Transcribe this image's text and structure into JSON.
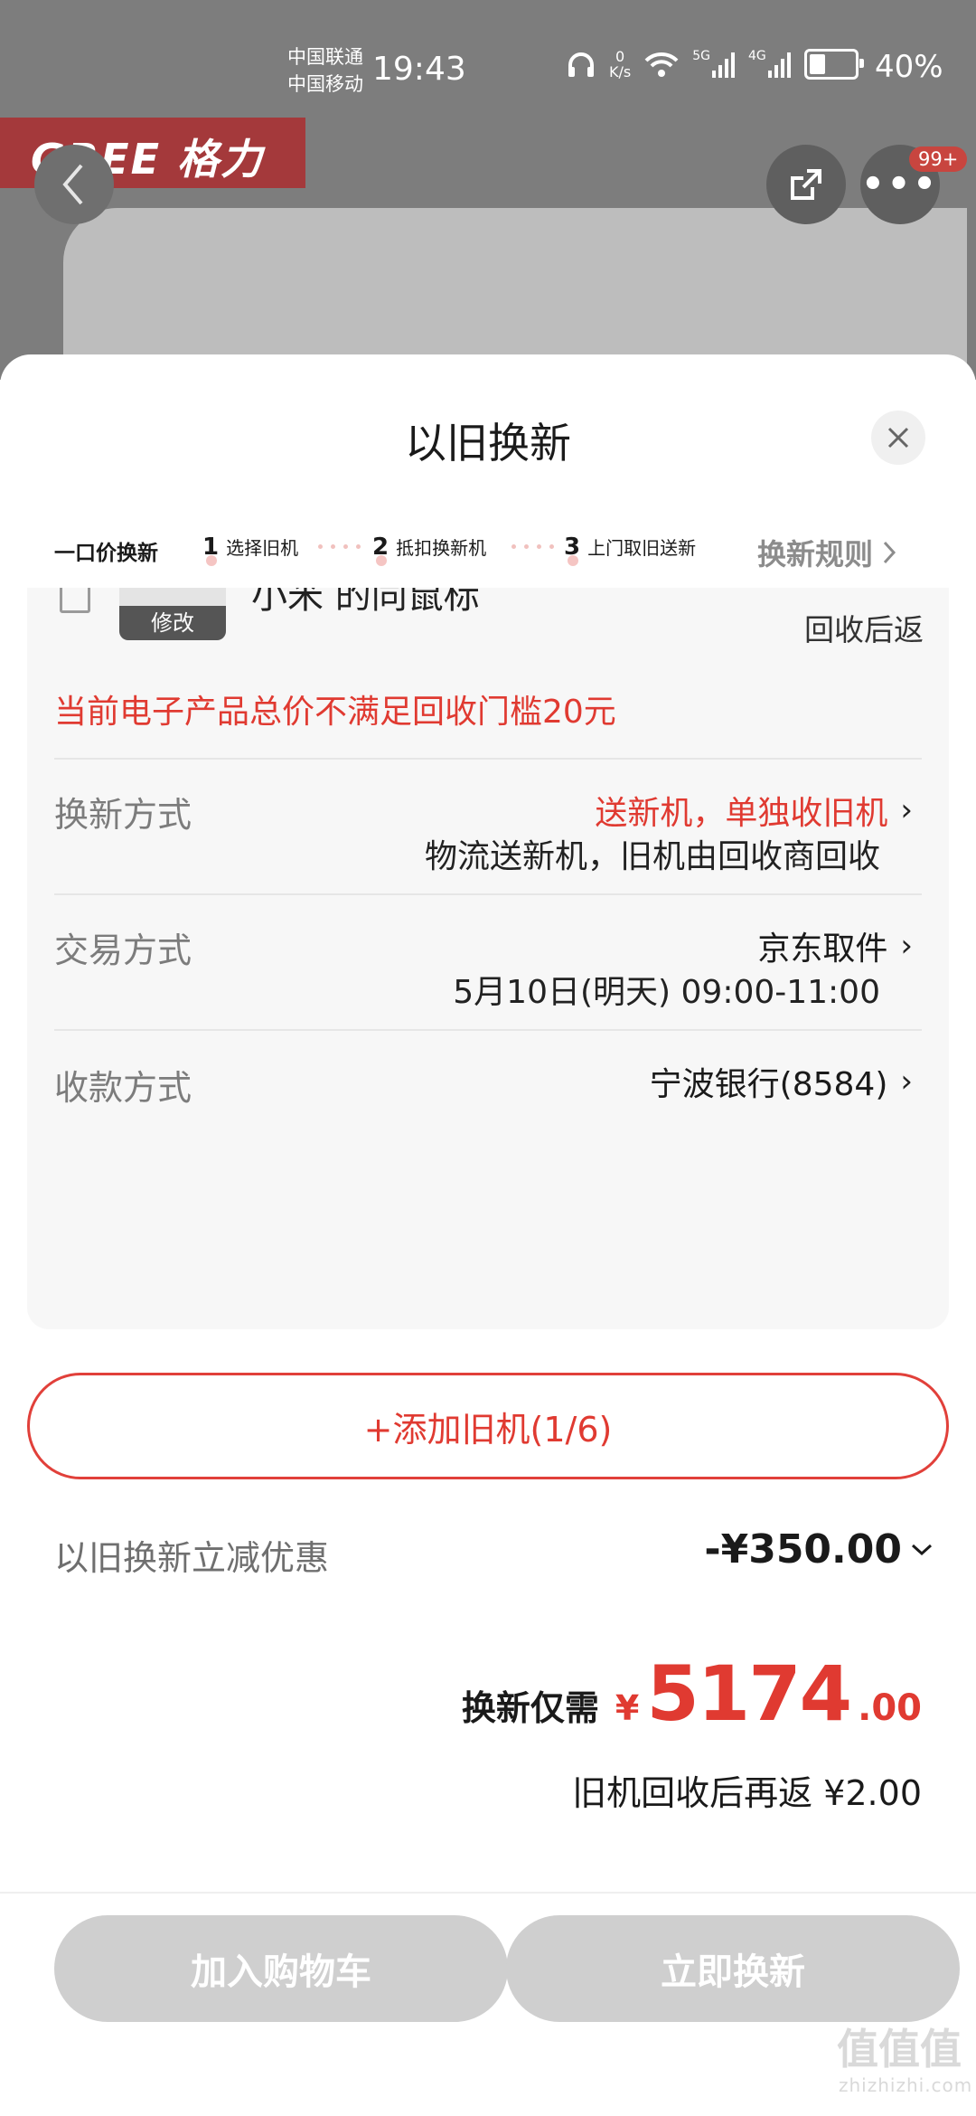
{
  "status_bar": {
    "carrier_1": "中国联通",
    "carrier_2": "中国移动",
    "time": "19:43",
    "net_speed_value": "0",
    "net_speed_unit": "K/s",
    "signal_1": "5G",
    "signal_2": "4G",
    "battery": "40%",
    "battery_level": 0.4
  },
  "header": {
    "brand": "GREE 格力",
    "more_badge": "99+"
  },
  "sheet": {
    "title": "以旧换新",
    "steps": {
      "lead": "一口价换新",
      "items": [
        {
          "num": "1",
          "label": "选择旧机"
        },
        {
          "num": "2",
          "label": "抵扣换新机"
        },
        {
          "num": "3",
          "label": "上门取旧送新"
        }
      ],
      "rules_label": "换新规则"
    },
    "old_item": {
      "name": "小米 的同鼠标",
      "edit_label": "修改",
      "return_note": "回收后返"
    },
    "warning": "当前电子产品总价不满足回收门槛20元",
    "rows": {
      "method": {
        "label": "换新方式",
        "value": "送新机，单独收旧机",
        "sub": "物流送新机，旧机由回收商回收"
      },
      "trade": {
        "label": "交易方式",
        "value": "京东取件",
        "sub": "5月10日(明天) 09:00-11:00"
      },
      "payment": {
        "label": "收款方式",
        "value": "宁波银行(8584)"
      }
    },
    "add_button": "+添加旧机(1/6)",
    "discount": {
      "label": "以旧换新立减优惠",
      "value": "-¥350.00"
    },
    "total": {
      "label": "换新仅需",
      "currency": "¥",
      "integer": "5174",
      "decimal": ".00"
    },
    "refund": "旧机回收后再返 ¥2.00"
  },
  "footer": {
    "add_to_cart": "加入购物车",
    "trade_now": "立即换新"
  },
  "watermark": {
    "main": "值值值",
    "sub": "zhizhizhi.com"
  },
  "colors": {
    "accent": "#e03a31",
    "disabled_button": "#cfcfcf"
  }
}
